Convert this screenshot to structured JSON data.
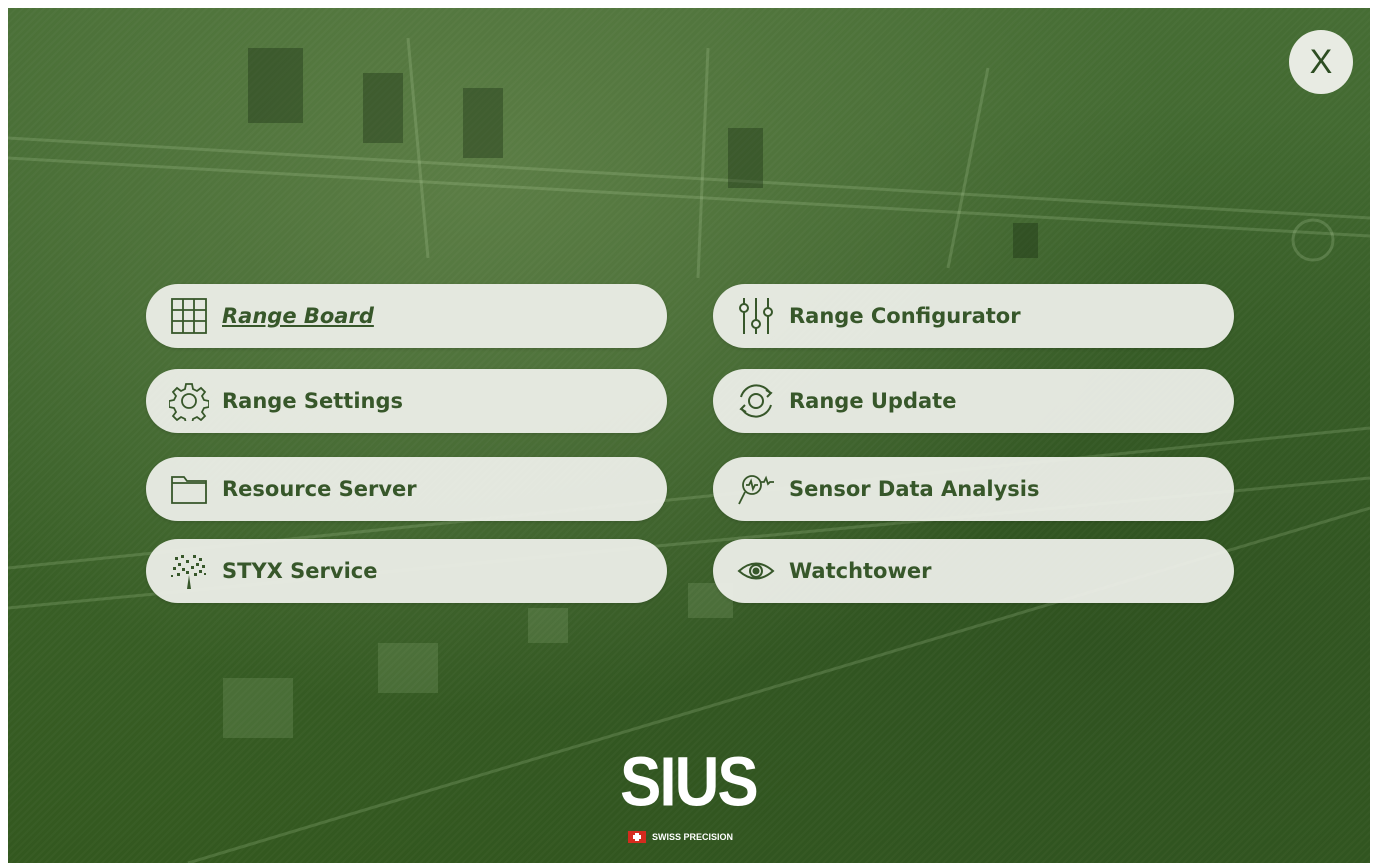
{
  "close_button": {
    "label": "X"
  },
  "menu": {
    "items": [
      {
        "label": "Range Board",
        "icon": "grid-icon",
        "active": true
      },
      {
        "label": "Range Configurator",
        "icon": "sliders-icon",
        "active": false
      },
      {
        "label": "Range Settings",
        "icon": "gear-icon",
        "active": false
      },
      {
        "label": "Range Update",
        "icon": "refresh-icon",
        "active": false
      },
      {
        "label": "Resource Server",
        "icon": "folder-icon",
        "active": false
      },
      {
        "label": "Sensor Data Analysis",
        "icon": "magnifier-signal-icon",
        "active": false
      },
      {
        "label": "STYX Service",
        "icon": "styx-tree-icon",
        "active": false
      },
      {
        "label": "Watchtower",
        "icon": "eye-icon",
        "active": false
      }
    ]
  },
  "logo": {
    "wordmark": "SIUS",
    "tagline": "SWISS PRECISION"
  },
  "colors": {
    "background": "#3f6530",
    "button": "#eceee8",
    "button_text": "#37572a",
    "flag_red": "#d52b1e"
  }
}
